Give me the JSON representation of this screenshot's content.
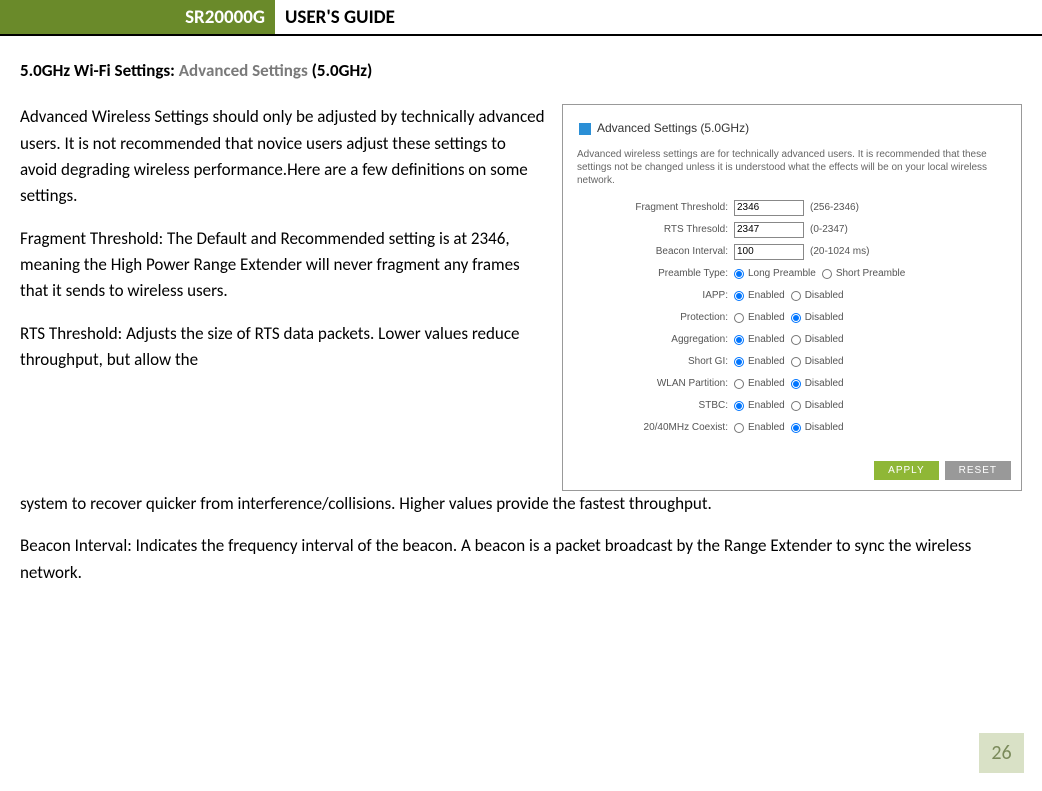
{
  "header": {
    "model": "SR20000G",
    "title": "USER'S GUIDE"
  },
  "section": {
    "pre": "5.0GHz Wi-Fi Settings: ",
    "mid": "Advanced Settings",
    "post": " (5.0GHz)"
  },
  "body": {
    "p1": "Advanced Wireless Settings should only be adjusted by technically advanced users. It is not recommended that novice users adjust these settings to avoid degrading wireless performance.Here are a few definitions on some settings.",
    "p2": "Fragment Threshold: The Default and Recommended setting is at 2346, meaning the High Power Range Extender will never fragment any frames that it sends to wireless users.",
    "p3a": "RTS Threshold: Adjusts the size of RTS data packets. Lower values reduce throughput, but allow the",
    "p3b": "system to recover quicker from interference/collisions. Higher values provide the fastest throughput.",
    "p4": "Beacon Interval: Indicates the frequency interval of the beacon. A beacon is a packet broadcast by the Range Extender to sync the wireless network."
  },
  "panel": {
    "title": "Advanced Settings (5.0GHz)",
    "desc": "Advanced wireless settings are for technically advanced users. It is recommended that these settings not be changed unless it is understood what the effects will be on your local wireless network.",
    "fields": {
      "frag_label": "Fragment Threshold:",
      "frag_value": "2346",
      "frag_hint": "(256-2346)",
      "rts_label": "RTS Thresold:",
      "rts_value": "2347",
      "rts_hint": "(0-2347)",
      "beacon_label": "Beacon Interval:",
      "beacon_value": "100",
      "beacon_hint": "(20-1024 ms)",
      "preamble_label": "Preamble Type:",
      "preamble_long": "Long Preamble",
      "preamble_short": "Short Preamble",
      "iapp_label": "IAPP:",
      "protection_label": "Protection:",
      "aggregation_label": "Aggregation:",
      "shortgi_label": "Short GI:",
      "wlan_label": "WLAN Partition:",
      "stbc_label": "STBC:",
      "coexist_label": "20/40MHz Coexist:",
      "enabled": "Enabled",
      "disabled": "Disabled"
    },
    "buttons": {
      "apply": "APPLY",
      "reset": "RESET"
    }
  },
  "page_number": "26"
}
